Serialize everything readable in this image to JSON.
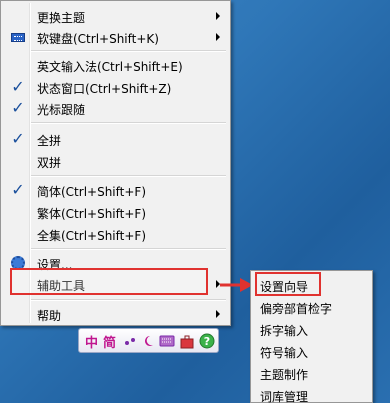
{
  "main_menu": {
    "items": [
      {
        "label": "更换主题"
      },
      {
        "label": "软键盘(Ctrl+Shift+K)"
      },
      {
        "label": "英文输入法(Ctrl+Shift+E)"
      },
      {
        "label": "状态窗口(Ctrl+Shift+Z)"
      },
      {
        "label": "光标跟随"
      },
      {
        "label": "全拼"
      },
      {
        "label": "双拼"
      },
      {
        "label": "简体(Ctrl+Shift+F)"
      },
      {
        "label": "繁体(Ctrl+Shift+F)"
      },
      {
        "label": "全集(Ctrl+Shift+F)"
      },
      {
        "label": "设置..."
      },
      {
        "label": "辅助工具"
      },
      {
        "label": "帮助"
      }
    ]
  },
  "sub_menu": {
    "items": [
      {
        "label": "设置向导"
      },
      {
        "label": "偏旁部首检字"
      },
      {
        "label": "拆字输入"
      },
      {
        "label": "符号输入"
      },
      {
        "label": "主题制作"
      },
      {
        "label": "词库管理"
      }
    ]
  },
  "ime_toolbar": {
    "zhong": "中",
    "jian": "简"
  },
  "colors": {
    "highlight_border": "#e0322f",
    "menu_background": "#f1f1f1",
    "check_color": "#1a4f9c",
    "desktop": "#2f77b8"
  },
  "icons": [
    "submenu-arrow-icon",
    "keyboard-icon",
    "checkmark-icon",
    "gear-icon",
    "red-arrow-icon"
  ]
}
